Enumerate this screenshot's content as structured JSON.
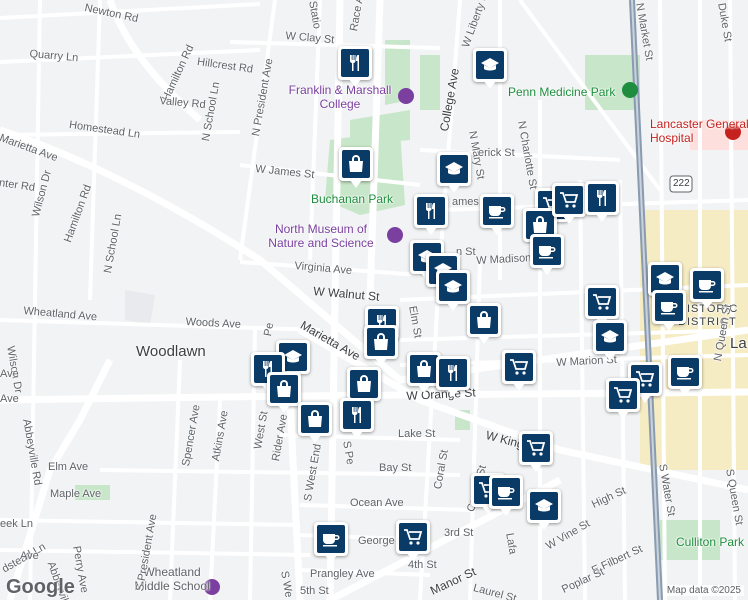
{
  "map": {
    "attribution": "Map data ©2025",
    "logo": "Google",
    "area_labels": [
      {
        "name": "woodlawn",
        "text": "Woodlawn"
      },
      {
        "name": "lancaster-general-hospital",
        "text": "Lancaster General Hospital"
      },
      {
        "name": "penn-medicine-park",
        "text": "Penn Medicine Park"
      },
      {
        "name": "culliton-park",
        "text": "Culliton Park"
      },
      {
        "name": "buchanan-park",
        "text": "Buchanan Park"
      },
      {
        "name": "franklin-marshall",
        "text": "Franklin & Marshall College"
      },
      {
        "name": "north-museum",
        "text": "North Museum of Nature and Science"
      },
      {
        "name": "wheatland-school",
        "text": "Wheatland Middle School"
      },
      {
        "name": "historic-district",
        "text": "Y HISTORIC DISTRICT"
      },
      {
        "name": "lancaster-edge",
        "text": "La"
      },
      {
        "name": "route-222",
        "text": "222"
      }
    ],
    "street_labels": [
      "Newton Rd",
      "Quarry Ln",
      "Hamilton Rd",
      "Hillcrest Rd",
      "Valley Rd",
      "N School Ln",
      "N President Ave",
      "Homestead Ln",
      "Marietta Ave",
      "Wilson Dr",
      "nter Rd",
      "Hamilton Rd",
      "N School Ln",
      "W James St",
      "Virginia Ave",
      "W Walnut St",
      "Wheatland Ave",
      "Woods Ave",
      "Marietta Ave",
      "W Clay St",
      "W Liberty St",
      "College Ave",
      "N Mary St",
      "N Charlotte St",
      "N Market St",
      "Duke St",
      "erick St",
      "ames St",
      "n St",
      "W Madison St",
      "Elm St",
      "W Orange St",
      "W Marion St",
      "N Queen St",
      "W King St",
      "Lake St",
      "Bay St",
      "Elm Ave",
      "Maple Ave",
      "Ocean Ave",
      "Coral St",
      "Crystal St",
      "3rd St",
      "George St",
      "4th St",
      "Prangley Ave",
      "5th St",
      "Manor St",
      "Laurel St",
      "W Vine St",
      "High St",
      "E Filbert St",
      "S Water St",
      "Poplar St",
      "S Queen St",
      "Lafa",
      "Abbeyville Rd",
      "Wilson Dr",
      "Spencer Ave",
      "Atkins Ave",
      "West St",
      "Rider Ave",
      "S West End",
      "S President Ave",
      "Perry Ave",
      "Abbeyville Rd",
      "dstead Ln",
      "eek Ln",
      "Ave",
      "Ave",
      "Ave",
      "S Pe",
      "S We",
      "Statio",
      "Race Ave",
      "Pe"
    ],
    "markers": [
      {
        "name": "restaurant-marker-race-ave",
        "icon": "restaurant-icon"
      },
      {
        "name": "school-marker-penn-medicine",
        "icon": "school-icon"
      },
      {
        "name": "shopping-marker-buchanan",
        "icon": "shopping-bag-icon"
      },
      {
        "name": "school-marker-frederick",
        "icon": "school-icon"
      },
      {
        "name": "restaurant-marker-james",
        "icon": "restaurant-icon"
      },
      {
        "name": "cafe-marker-james-1",
        "icon": "cafe-icon"
      },
      {
        "name": "grocery-marker-charlotte",
        "icon": "grocery-cart-icon"
      },
      {
        "name": "shopping-marker-charlotte",
        "icon": "shopping-bag-icon"
      },
      {
        "name": "grocery-marker-market-1",
        "icon": "grocery-cart-icon"
      },
      {
        "name": "restaurant-marker-market",
        "icon": "restaurant-icon"
      },
      {
        "name": "school-marker-walnut-1",
        "icon": "school-icon"
      },
      {
        "name": "school-marker-walnut-2",
        "icon": "school-icon"
      },
      {
        "name": "school-marker-walnut-3",
        "icon": "school-icon"
      },
      {
        "name": "cafe-marker-madison",
        "icon": "cafe-icon"
      },
      {
        "name": "shopping-marker-lemon",
        "icon": "shopping-bag-icon"
      },
      {
        "name": "grocery-marker-queen",
        "icon": "grocery-cart-icon"
      },
      {
        "name": "cafe-marker-duke",
        "icon": "cafe-icon"
      },
      {
        "name": "school-marker-duke",
        "icon": "school-icon"
      },
      {
        "name": "cafe-marker-queen-2",
        "icon": "cafe-icon"
      },
      {
        "name": "restaurant-marker-elm",
        "icon": "restaurant-icon"
      },
      {
        "name": "shopping-marker-marietta",
        "icon": "shopping-bag-icon"
      },
      {
        "name": "school-marker-marion",
        "icon": "school-icon"
      },
      {
        "name": "grocery-marker-marion",
        "icon": "grocery-cart-icon"
      },
      {
        "name": "shopping-marker-orange",
        "icon": "shopping-bag-icon"
      },
      {
        "name": "restaurant-marker-orange",
        "icon": "restaurant-icon"
      },
      {
        "name": "grocery-marker-orange-e",
        "icon": "grocery-cart-icon"
      },
      {
        "name": "grocery-marker-orange-e2",
        "icon": "grocery-cart-icon"
      },
      {
        "name": "cafe-marker-orange-e",
        "icon": "cafe-icon"
      },
      {
        "name": "school-marker-woodlawn",
        "icon": "school-icon"
      },
      {
        "name": "restaurant-marker-woodlawn",
        "icon": "restaurant-icon"
      },
      {
        "name": "shopping-marker-woodlawn",
        "icon": "shopping-bag-icon"
      },
      {
        "name": "shopping-marker-west-end",
        "icon": "shopping-bag-icon"
      },
      {
        "name": "shopping-marker-orange-w",
        "icon": "shopping-bag-icon"
      },
      {
        "name": "restaurant-marker-orange-w",
        "icon": "restaurant-icon"
      },
      {
        "name": "grocery-marker-king",
        "icon": "grocery-cart-icon"
      },
      {
        "name": "grocery-marker-crystal",
        "icon": "grocery-cart-icon"
      },
      {
        "name": "cafe-marker-crystal",
        "icon": "cafe-icon"
      },
      {
        "name": "school-marker-vine",
        "icon": "school-icon"
      },
      {
        "name": "cafe-marker-george",
        "icon": "cafe-icon"
      },
      {
        "name": "grocery-marker-george",
        "icon": "grocery-cart-icon"
      }
    ],
    "colors": {
      "marker": "#0a3a66",
      "park": "#c8e6c9",
      "road": "#ffffff",
      "highway": "#8a9bb0",
      "downtown": "#f6ecc4"
    }
  }
}
